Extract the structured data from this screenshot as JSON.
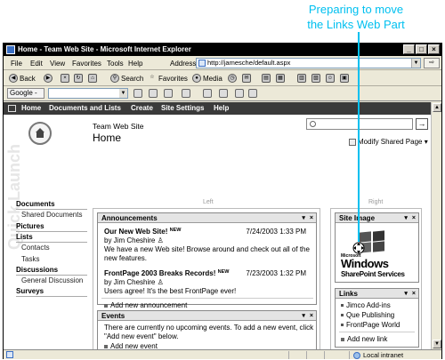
{
  "callout": {
    "line1": "Preparing to move",
    "line2": "the Links Web Part"
  },
  "window": {
    "title": "Home - Team Web Site - Microsoft Internet Explorer",
    "min": "_",
    "max": "□",
    "close": "×"
  },
  "menubar": {
    "items": [
      "File",
      "Edit",
      "View",
      "Favorites",
      "Tools",
      "Help"
    ],
    "address_label": "Address",
    "address_value": "http://jamesche/default.aspx"
  },
  "toolbar": {
    "back": "Back",
    "search": "Search",
    "favorites": "Favorites",
    "media": "Media"
  },
  "googlebar": {
    "logo": "Google -"
  },
  "statusbar": {
    "zone": "Local intranet"
  },
  "sharepoint": {
    "topnav": [
      "Home",
      "Documents and Lists",
      "Create",
      "Site Settings",
      "Help"
    ],
    "site_subtitle": "Team Web Site",
    "site_title": "Home",
    "modify_link": "Modify Shared Page ▾",
    "search_go": "→",
    "quick_launch": {
      "watermark": "Quick Launch",
      "documents": "Documents",
      "shared_documents": "Shared Documents",
      "pictures": "Pictures",
      "lists": "Lists",
      "contacts": "Contacts",
      "tasks": "Tasks",
      "discussions": "Discussions",
      "general_discussion": "General Discussion",
      "surveys": "Surveys"
    },
    "zones": {
      "left": "Left",
      "right": "Right"
    },
    "announcements": {
      "title": "Announcements",
      "items": [
        {
          "title": "Our New Web Site!",
          "new": "NEW",
          "date": "7/24/2003 1:33 PM",
          "by": "by Jim Cheshire",
          "body": "We have a new Web site!  Browse around and check out all of the new features."
        },
        {
          "title": "FrontPage 2003 Breaks Records!",
          "new": "NEW",
          "date": "7/23/2003 1:32 PM",
          "by": "by Jim Cheshire",
          "body": "Users agree!  It's the best FrontPage ever!"
        }
      ],
      "add_link": "Add new announcement"
    },
    "events": {
      "title": "Events",
      "body": "There are currently no upcoming events. To add a new event, click \"Add new event\" below.",
      "add_link": "Add new event"
    },
    "site_image": {
      "title": "Site Image",
      "ms": "Microsoft",
      "windows": "Windows",
      "sps": "SharePoint Services"
    },
    "links": {
      "title": "Links",
      "items": [
        "Jimco Add-ins",
        "Que Publishing",
        "FrontPage World"
      ],
      "add_link": "Add new link"
    },
    "wp_menu": "▾",
    "wp_close": "×"
  },
  "colors": {
    "callout": "#00c0f0",
    "topnav": "#3a3a3a",
    "wp_title_bg": "#e4e4e4"
  }
}
